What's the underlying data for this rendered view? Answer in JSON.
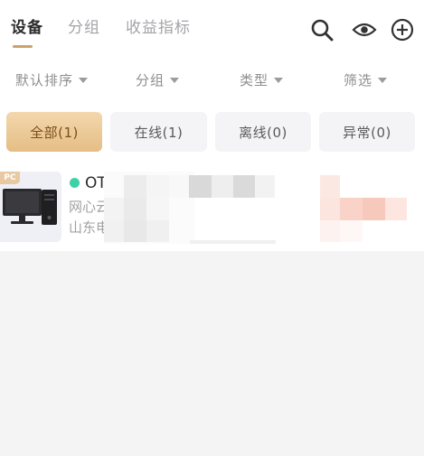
{
  "tabs": [
    {
      "label": "设备",
      "active": true
    },
    {
      "label": "分组",
      "active": false
    },
    {
      "label": "收益指标",
      "active": false
    }
  ],
  "toolbar_icons": [
    "search-icon",
    "eye-icon",
    "add-circle-icon"
  ],
  "filters": [
    {
      "label": "默认排序"
    },
    {
      "label": "分组"
    },
    {
      "label": "类型"
    },
    {
      "label": "筛选"
    }
  ],
  "status_chips": [
    {
      "label": "全部(1)",
      "active": true
    },
    {
      "label": "在线(1)",
      "active": false
    },
    {
      "label": "离线(0)",
      "active": false
    },
    {
      "label": "异常(0)",
      "active": false
    }
  ],
  "device": {
    "badge": "PC",
    "status": "online",
    "name": "OT",
    "line1": "网心云",
    "line2": "山东电"
  },
  "colors": {
    "accent": "#c9a36a",
    "chip_active_from": "#f3d8ad",
    "chip_active_to": "#e5bd85",
    "online": "#3fd0a8",
    "page_bg": "#f4f4f5"
  }
}
